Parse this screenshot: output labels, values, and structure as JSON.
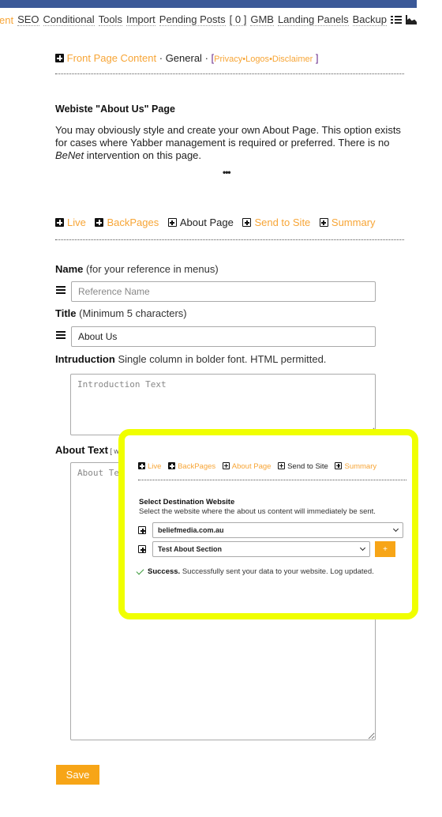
{
  "nav": {
    "items": [
      {
        "label": "ent",
        "active": true
      },
      {
        "label": "SEO"
      },
      {
        "label": "Conditional"
      },
      {
        "label": "Tools"
      },
      {
        "label": "Import"
      },
      {
        "label": "Pending Posts"
      },
      {
        "label": "[ 0 ]"
      },
      {
        "label": "GMB"
      },
      {
        "label": "Landing Panels"
      },
      {
        "label": "Backup"
      }
    ],
    "icons": [
      "list-icon",
      "chart-icon"
    ]
  },
  "breadcrumb": {
    "front": "Front Page Content",
    "sep": "·",
    "general": "General",
    "open": "[",
    "privacy": "Privacy",
    "dot": "•",
    "logos": "Logos",
    "disclaimer": "Disclaimer",
    "close": "]"
  },
  "intro": {
    "title": "Webiste \"About Us\" Page",
    "desc_1": "You may obviously style and create your own About Page. This option exists for cases where Yabber management is required or preferred. There is no ",
    "desc_em": "BeNet",
    "desc_2": " intervention on this page.",
    "ellipsis": "•••"
  },
  "tabs": [
    {
      "label": "Live",
      "style": "orange",
      "icon": "filled"
    },
    {
      "label": "BackPages",
      "style": "orange",
      "icon": "filled"
    },
    {
      "label": "About Page",
      "style": "dark",
      "icon": "outline"
    },
    {
      "label": "Send to Site",
      "style": "orange",
      "icon": "outline"
    },
    {
      "label": "Summary",
      "style": "orange",
      "icon": "outline"
    }
  ],
  "form": {
    "name_label": "Name",
    "name_hint": " (for your reference in menus)",
    "name_placeholder": "Reference Name",
    "name_value": "",
    "title_label": "Title",
    "title_hint": " (Minimum 5 characters)",
    "title_value": "About Us",
    "intro_label": "Intruduction",
    "intro_hint": " Single column in bolder font. HTML permitted.",
    "intro_placeholder": "Introduction Text",
    "about_label": "About Text",
    "about_hint": " [ wi",
    "about_placeholder": "About Text",
    "save_label": "Save"
  },
  "overlay": {
    "highlight_color": "#f0ff00",
    "tabs": [
      {
        "label": "Live",
        "style": "orange",
        "icon": "filled"
      },
      {
        "label": "BackPages",
        "style": "orange",
        "icon": "filled"
      },
      {
        "label": "About Page",
        "style": "orange",
        "icon": "outline"
      },
      {
        "label": "Send to Site",
        "style": "dark",
        "icon": "outline"
      },
      {
        "label": "Summary",
        "style": "orange",
        "icon": "outline"
      }
    ],
    "section_title": "Select Destination Website",
    "section_desc": "Select the website where the about us content will immediately be sent.",
    "website_select": "beliefmedia.com.au",
    "section_select": "Test About Section",
    "add_label": "+",
    "success_strong": "Success.",
    "success_text": " Successfully sent your data to your website. Log updated."
  },
  "colors": {
    "brand_bar": "#3b5998",
    "accent": "#f7a517",
    "link": "#f7a536",
    "success": "#3a9a3a"
  }
}
